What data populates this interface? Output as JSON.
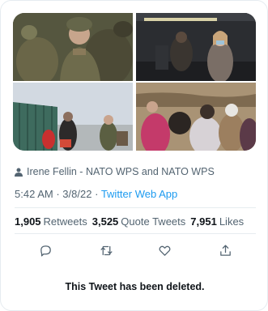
{
  "tweet": {
    "author_line": "Irene Fellin - NATO WPS and NATO WPS",
    "time": "5:42 AM",
    "separator": "·",
    "date": "3/8/22",
    "source_app": "Twitter Web App",
    "stats": {
      "retweets_count": "1,905",
      "retweets_label": "Retweets",
      "quotes_count": "3,525",
      "quotes_label": "Quote Tweets",
      "likes_count": "7,951",
      "likes_label": "Likes"
    },
    "actions": [
      "reply-icon",
      "retweet-icon",
      "like-icon",
      "share-icon"
    ],
    "deleted_notice": "This Tweet has been deleted."
  },
  "colors": {
    "link": "#1d9bf0",
    "muted_text": "#536471",
    "primary_text": "#0f1419",
    "border": "#e6ecf0"
  }
}
